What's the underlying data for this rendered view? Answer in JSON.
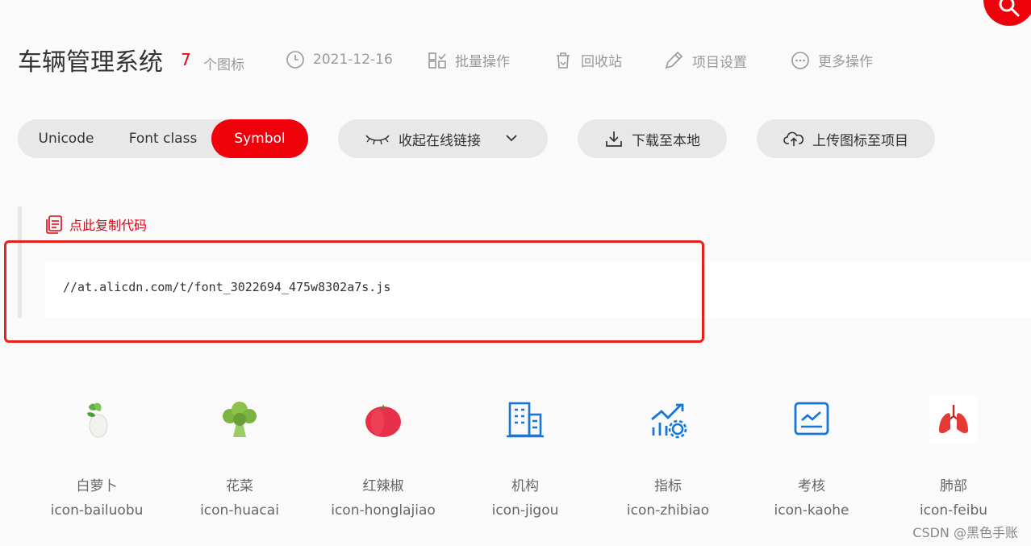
{
  "header": {
    "project_title": "车辆管理系统",
    "icon_count": "7",
    "icon_count_unit": "个图标",
    "date": "2021-12-16",
    "batch_label": "批量操作",
    "recycle_label": "回收站",
    "settings_label": "项目设置",
    "more_label": "更多操作"
  },
  "format_tabs": [
    "Unicode",
    "Font class",
    "Symbol"
  ],
  "active_format": "Symbol",
  "toolbar": {
    "collapse_link_label": "收起在线链接",
    "download_label": "下载至本地",
    "upload_label": "上传图标至项目"
  },
  "code_panel": {
    "copy_label": "点此复制代码",
    "code": "//at.alicdn.com/t/font_3022694_475w8302a7s.js"
  },
  "icons": [
    {
      "name": "白萝卜",
      "code": "icon-bailuobu"
    },
    {
      "name": "花菜",
      "code": "icon-huacai"
    },
    {
      "name": "红辣椒",
      "code": "icon-honglajiao"
    },
    {
      "name": "机构",
      "code": "icon-jigou"
    },
    {
      "name": "指标",
      "code": "icon-zhibiao"
    },
    {
      "name": "考核",
      "code": "icon-kaohe"
    },
    {
      "name": "肺部",
      "code": "icon-feibu"
    }
  ],
  "watermark": "CSDN @黑色手账",
  "colors": {
    "accent": "#f0000a",
    "icon_blue": "#1677d9",
    "highlight_border": "#e8201c"
  }
}
